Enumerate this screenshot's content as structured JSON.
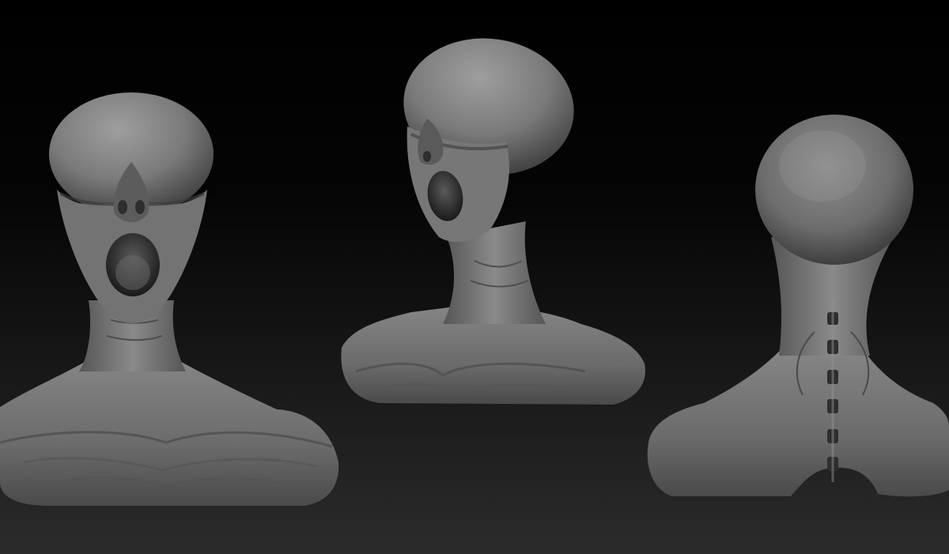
{
  "scene": {
    "subject": "sculpt-render",
    "background_top": "#000000",
    "background_bottom": "#2a2a2a",
    "material_light": "#9a9a9a",
    "material_mid": "#6e6e6e",
    "material_dark": "#2c2c2c"
  },
  "views": [
    {
      "name": "front-view"
    },
    {
      "name": "three-quarter-view"
    },
    {
      "name": "back-view"
    }
  ]
}
